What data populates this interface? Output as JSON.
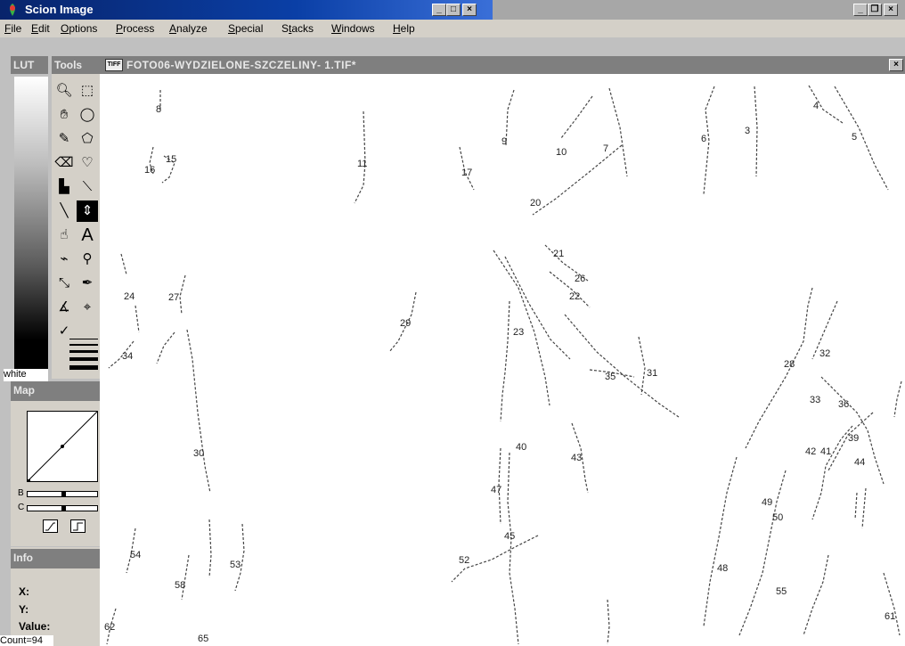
{
  "app": {
    "title": "Scion Image"
  },
  "menu": {
    "items": [
      {
        "label": "File",
        "u": "F",
        "rest": "ile"
      },
      {
        "label": "Edit",
        "u": "E",
        "rest": "dit"
      },
      {
        "label": "Options",
        "u": "O",
        "rest": "ptions"
      },
      {
        "label": "Process",
        "u": "P",
        "rest": "rocess"
      },
      {
        "label": "Analyze",
        "u": "A",
        "rest": "nalyze"
      },
      {
        "label": "Special",
        "u": "S",
        "rest": "pecial"
      },
      {
        "label": "Stacks",
        "pre": "S",
        "u": "t",
        "rest": "acks"
      },
      {
        "label": "Windows",
        "u": "W",
        "rest": "indows"
      },
      {
        "label": "Help",
        "u": "H",
        "rest": "elp"
      }
    ]
  },
  "panels": {
    "lut_title": "LUT",
    "tools_title": "Tools",
    "lut_bottom_label": "white",
    "map_title": "Map",
    "map_b_label": "B",
    "map_c_label": "C",
    "info_title": "Info",
    "info_x": "X:",
    "info_y": "Y:",
    "info_value": "Value:",
    "info_count": "Count=94"
  },
  "image_window": {
    "title": "FOTO06-WYDZIELONE-SZCZELINY- 1.TIF*",
    "badge": "TIFF",
    "labels": [
      "8",
      "15",
      "16",
      "11",
      "17",
      "9",
      "10",
      "7",
      "20",
      "6",
      "3",
      "4",
      "5",
      "21",
      "26",
      "22",
      "24",
      "27",
      "29",
      "23",
      "34",
      "35",
      "31",
      "28",
      "32",
      "33",
      "36",
      "30",
      "40",
      "43",
      "42",
      "41",
      "39",
      "44",
      "47",
      "49",
      "50",
      "45",
      "54",
      "53",
      "52",
      "58",
      "48",
      "55",
      "62",
      "65",
      "61"
    ]
  },
  "colors": {
    "title_active": "#0a246a",
    "title_inactive": "#a7a7a7",
    "panel_title": "#7f7f7f"
  }
}
